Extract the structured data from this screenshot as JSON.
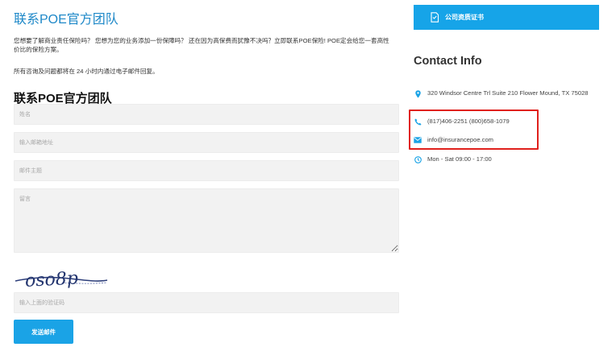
{
  "left": {
    "title": "联系POE官方团队",
    "intro": "您想要了解商业责任保险吗？ 您想为您的业务添加一份保障吗？ 还在因为高保费而犹豫不决吗？立即联系POE保险! POE定会给您一套高性价比的保险方案。",
    "note": "所有咨询及问题都将在 24 小时内通过电子邮件回复。",
    "form_title": "联系POE官方团队",
    "form": {
      "name_placeholder": "姓名",
      "email_placeholder": "输入邮箱地址",
      "subject_placeholder": "邮件主题",
      "message_placeholder": "留言",
      "captcha_text": "oso8p",
      "captcha_placeholder": "输入上面的验证码",
      "submit_label": "发送邮件"
    }
  },
  "right": {
    "cert_button_label": "公司资质证书",
    "contact_title": "Contact Info",
    "address": "320 Windsor Centre Trl Suite 210 Flower Mound, TX 75028",
    "phones": "(817)406-2251 (800)658-1079",
    "email": "info@insurancepoe.com",
    "hours": "Mon - Sat 09:00 - 17:00"
  },
  "icons": {
    "cert": "certificate-icon",
    "address": "map-marker-icon",
    "phone": "phone-icon",
    "email": "envelope-icon",
    "hours": "clock-icon"
  },
  "colors": {
    "accent_blue": "#1aa3e6",
    "title_blue": "#1e88c8",
    "highlight_red": "#e0201c",
    "field_bg": "#f2f2f2"
  }
}
